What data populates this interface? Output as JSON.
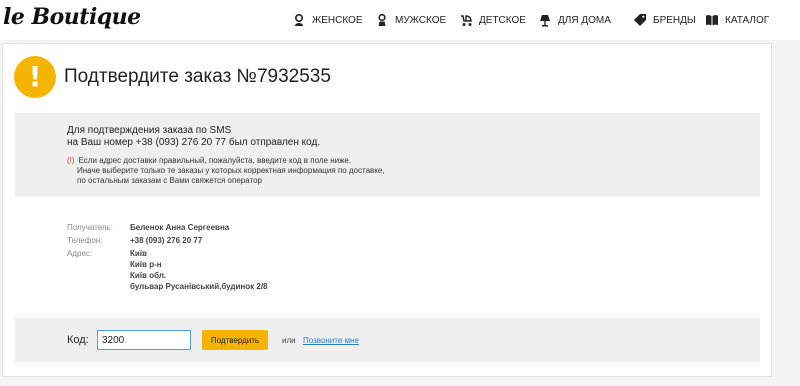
{
  "brand": {
    "logo": "le Boutique"
  },
  "nav": {
    "items": [
      {
        "label": "ЖЕНСКОЕ",
        "icon": "woman-icon"
      },
      {
        "label": "МУЖСКОЕ",
        "icon": "man-icon"
      },
      {
        "label": "ДЕТСКОЕ",
        "icon": "stroller-icon"
      },
      {
        "label": "ДЛЯ ДОМА",
        "icon": "lamp-icon"
      },
      {
        "label": "БРЕНДЫ",
        "icon": "tag-icon"
      },
      {
        "label": "КАТАЛОГ",
        "icon": "book-icon"
      }
    ]
  },
  "order": {
    "title": "Подтвердите заказ №7932535"
  },
  "sms_info": {
    "line1": "Для подтверждения заказа по SMS",
    "line2": "на Ваш номер +38 (093) 276 20 77 был отправлен код.",
    "note_mark": "(!)",
    "note_1": "Если адрес доставки правильный, пожалуйста, введите код в поле ниже.",
    "note_2": "Иначе выберите только те заказы у которых корректная информация по доставке,",
    "note_3": "по остальным заказам с Вами свяжется оператор"
  },
  "details": {
    "recipient_label": "Получатель:",
    "recipient_value": "Беленок Анна Сергеевна",
    "phone_label": "Телефон:",
    "phone_value": "+38 (093) 276 20 77",
    "address_label": "Адрес:",
    "address_lines": [
      "Київ",
      "Київ р-н",
      "Київ обл.",
      "бульвар Русанівський,будинок 2/8"
    ]
  },
  "code_form": {
    "label": "Код:",
    "value": "3200",
    "confirm_label": "Подтвердить",
    "or_text": "или",
    "call_link": "Позвоните мне"
  },
  "colors": {
    "accent": "#f5b400",
    "link": "#2a7ccf",
    "input_border": "#4aa3df"
  }
}
